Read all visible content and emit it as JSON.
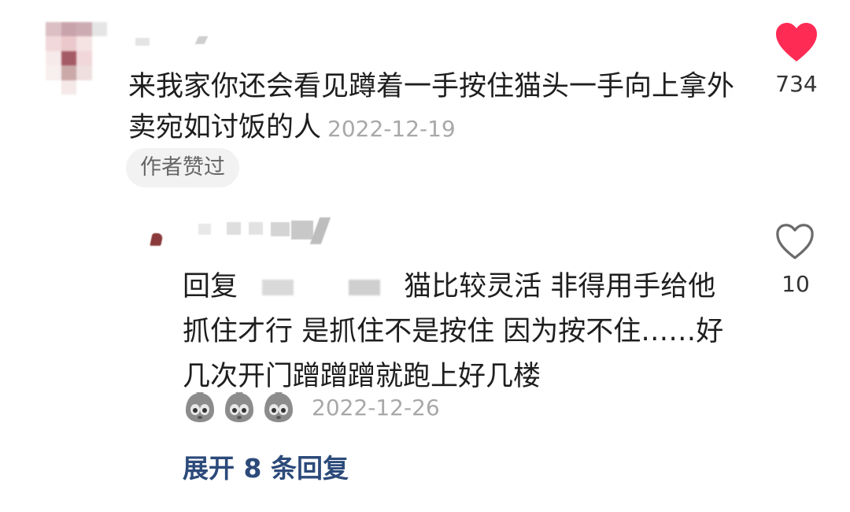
{
  "comment": {
    "text": "来我家你还会看见蹲着一手按住猫头一手向上拿外卖宛如讨饭的人",
    "date": "2022-12-19",
    "badge": "作者赞过",
    "like_count": "734",
    "liked": true,
    "like_color": "#fe2c55"
  },
  "reply": {
    "prefix": "回复",
    "text": "猫比较灵活 非得用手给他抓住才行 是抓住不是按住 因为按不住……好几次开门蹭蹭蹭就跑上好几楼",
    "emojis": [
      "crying-face-emoji",
      "crying-face-emoji",
      "crying-face-emoji"
    ],
    "date": "2022-12-26",
    "like_count": "10",
    "liked": false
  },
  "expand": {
    "label": "展开 8 条回复",
    "color": "#2c4a7a"
  }
}
